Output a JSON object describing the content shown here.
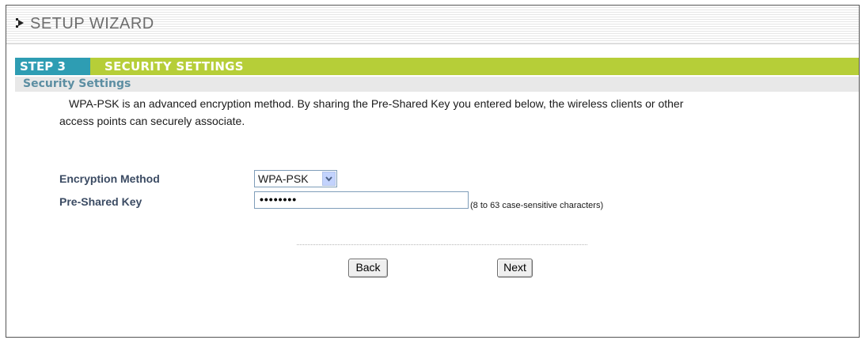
{
  "header": {
    "title": "SETUP WIZARD",
    "icon": "arrow-right-icon"
  },
  "step": {
    "number": "STEP 3",
    "title": "SECURITY SETTINGS"
  },
  "section": {
    "title": "Security Settings",
    "description_line1": "WPA-PSK is an advanced encryption method.  By sharing the Pre-Shared Key you entered below, the wireless clients or other",
    "description_line2": "access points can securely associate."
  },
  "form": {
    "encryption_label": "Encryption Method",
    "encryption_value": "WPA-PSK",
    "psk_label": "Pre-Shared Key",
    "psk_value": "••••••••",
    "psk_hint": "(8 to 63 case-sensitive characters)"
  },
  "buttons": {
    "back": "Back",
    "next": "Next"
  },
  "colors": {
    "step_number_bg": "#2e9db3",
    "step_bar_bg": "#b6ce38",
    "label_text": "#3b4b63",
    "subtitle_text": "#5c8ea2"
  }
}
